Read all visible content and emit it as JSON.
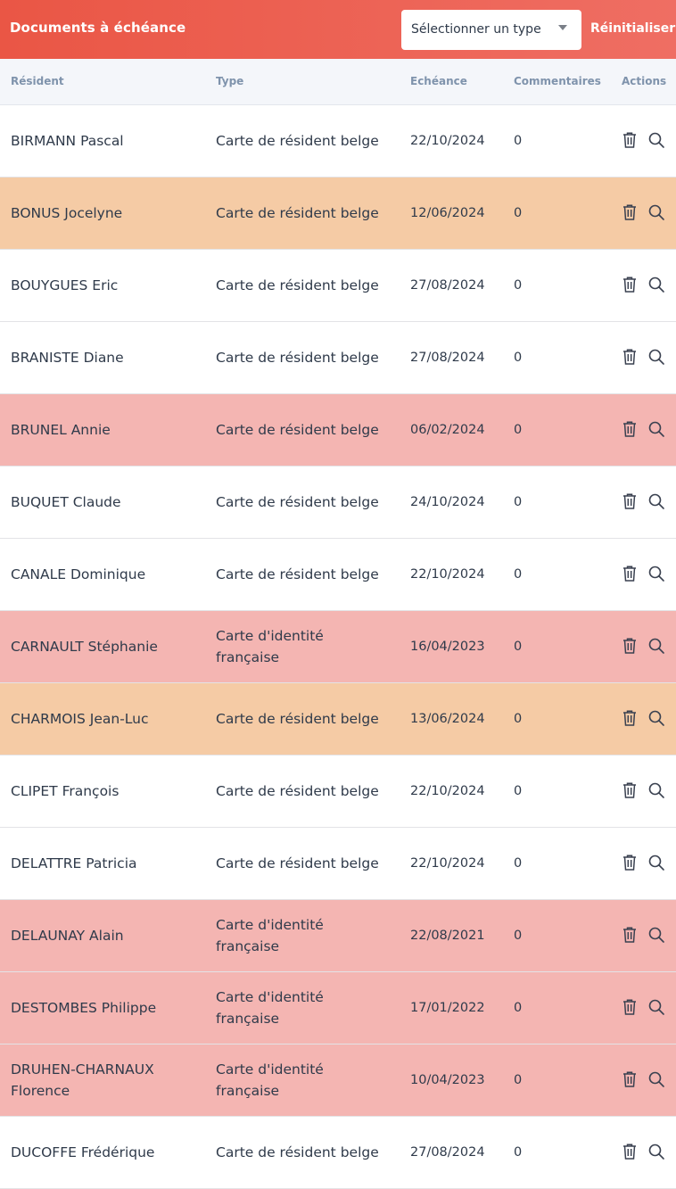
{
  "header": {
    "title": "Documents à échéance",
    "type_select": {
      "value": "Sélectionner un type"
    },
    "reset_label": "Réinitialiser",
    "colors": {
      "gradient_start": "#ea5645",
      "gradient_end": "#ef6e63"
    }
  },
  "table": {
    "columns": [
      "Résident",
      "Type",
      "Echéance",
      "Commentaires",
      "Actions"
    ],
    "status_colors": {
      "white": "#ffffff",
      "orange": "#f5cba5",
      "red": "#f4b5b2"
    },
    "action_icons": [
      "trash-icon",
      "search-icon"
    ],
    "rows": [
      {
        "resident": "BIRMANN Pascal",
        "type": "Carte de résident belge",
        "due": "22/10/2024",
        "comments": "0",
        "status": "white"
      },
      {
        "resident": "BONUS Jocelyne",
        "type": "Carte de résident belge",
        "due": "12/06/2024",
        "comments": "0",
        "status": "orange"
      },
      {
        "resident": "BOUYGUES Eric",
        "type": "Carte de résident belge",
        "due": "27/08/2024",
        "comments": "0",
        "status": "white"
      },
      {
        "resident": "BRANISTE Diane",
        "type": "Carte de résident belge",
        "due": "27/08/2024",
        "comments": "0",
        "status": "white"
      },
      {
        "resident": "BRUNEL Annie",
        "type": "Carte de résident belge",
        "due": "06/02/2024",
        "comments": "0",
        "status": "red"
      },
      {
        "resident": "BUQUET Claude",
        "type": "Carte de résident belge",
        "due": "24/10/2024",
        "comments": "0",
        "status": "white"
      },
      {
        "resident": "CANALE Dominique",
        "type": "Carte de résident belge",
        "due": "22/10/2024",
        "comments": "0",
        "status": "white"
      },
      {
        "resident": "CARNAULT Stéphanie",
        "type": "Carte d'identité française",
        "due": "16/04/2023",
        "comments": "0",
        "status": "red"
      },
      {
        "resident": "CHARMOIS Jean-Luc",
        "type": "Carte de résident belge",
        "due": "13/06/2024",
        "comments": "0",
        "status": "orange"
      },
      {
        "resident": "CLIPET François",
        "type": "Carte de résident belge",
        "due": "22/10/2024",
        "comments": "0",
        "status": "white"
      },
      {
        "resident": "DELATTRE Patricia",
        "type": "Carte de résident belge",
        "due": "22/10/2024",
        "comments": "0",
        "status": "white"
      },
      {
        "resident": "DELAUNAY Alain",
        "type": "Carte d'identité française",
        "due": "22/08/2021",
        "comments": "0",
        "status": "red"
      },
      {
        "resident": "DESTOMBES Philippe",
        "type": "Carte d'identité française",
        "due": "17/01/2022",
        "comments": "0",
        "status": "red"
      },
      {
        "resident": "DRUHEN-CHARNAUX Florence",
        "type": "Carte d'identité française",
        "due": "10/04/2023",
        "comments": "0",
        "status": "red"
      },
      {
        "resident": "DUCOFFE Frédérique",
        "type": "Carte de résident belge",
        "due": "27/08/2024",
        "comments": "0",
        "status": "white"
      }
    ]
  }
}
